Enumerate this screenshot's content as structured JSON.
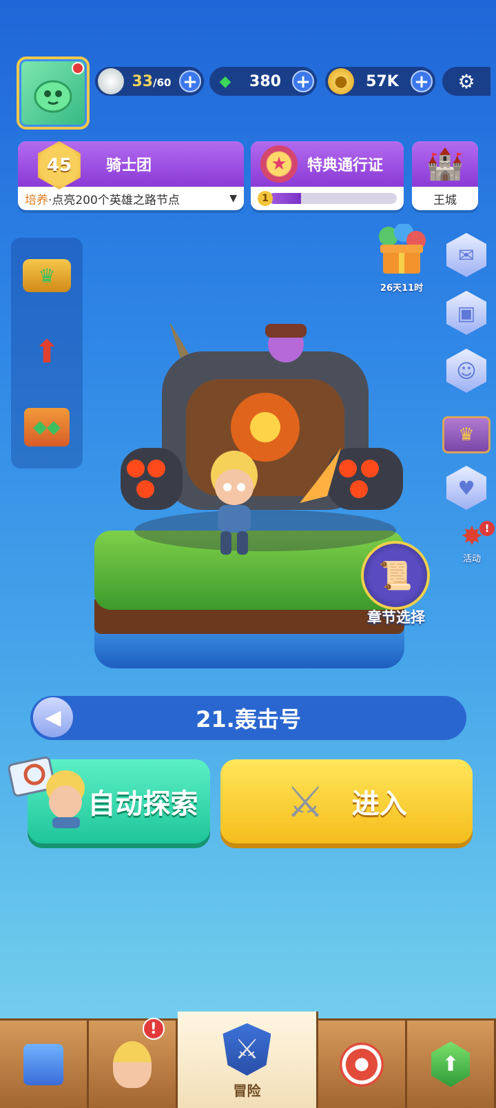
{
  "top_bar": {
    "energy": {
      "current": "33",
      "max": "/60",
      "icon": "energy-stone-icon"
    },
    "gems": {
      "value": "380",
      "icon": "green-gem-icon"
    },
    "coins": {
      "value": "57K",
      "icon": "gold-coin-icon"
    },
    "settings_icon": "gear-icon"
  },
  "guild": {
    "level": "45",
    "title": "骑士团",
    "tip_prefix": "培养",
    "tip_text": "·点亮200个英雄之路节点"
  },
  "pass": {
    "title": "特典通行证",
    "level": "1",
    "progress": 0.25
  },
  "castle": {
    "label": "王城"
  },
  "gift": {
    "timer": "26天11时"
  },
  "event": {
    "label": "活动"
  },
  "chapter_select": {
    "label": "章节选择"
  },
  "stage": {
    "title": "21.轰击号"
  },
  "actions": {
    "auto_explore": "自动探索",
    "enter": "进入"
  },
  "nav": {
    "tabs": [
      {
        "icon": "shop-icon",
        "label": ""
      },
      {
        "icon": "hero-icon",
        "label": "",
        "alert": "!"
      },
      {
        "icon": "adventure-icon",
        "label": "冒险"
      },
      {
        "icon": "battle-icon",
        "label": ""
      },
      {
        "icon": "upgrade-icon",
        "label": ""
      }
    ]
  },
  "colors": {
    "banner_purple": "#8a3ad6",
    "auto_green": "#1fc59a",
    "enter_yellow": "#f5bd1c"
  }
}
